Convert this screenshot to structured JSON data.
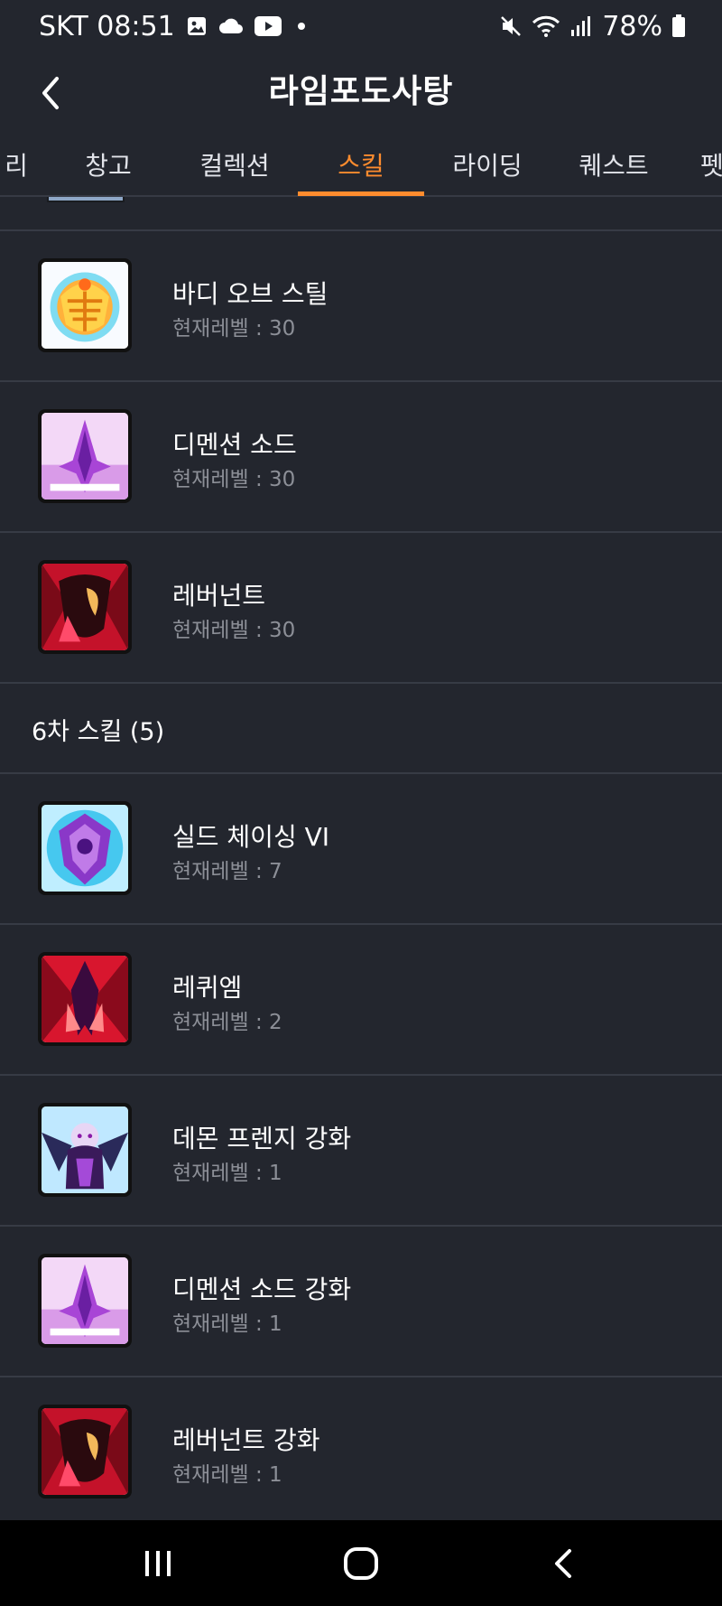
{
  "status_bar": {
    "carrier_time": "SKT 08:51",
    "battery": "78%",
    "icons": [
      "gallery-icon",
      "cloud-icon",
      "youtube-icon",
      "mute-icon",
      "wifi-icon",
      "signal-icon",
      "battery-icon"
    ]
  },
  "header": {
    "title": "라임포도사탕",
    "back_icon": "chevron-left-icon"
  },
  "tabs": [
    {
      "label": "리"
    },
    {
      "label": "창고"
    },
    {
      "label": "컬렉션"
    },
    {
      "label": "스킬",
      "active": true
    },
    {
      "label": "라이딩"
    },
    {
      "label": "퀘스트"
    },
    {
      "label": "펫"
    }
  ],
  "colors": {
    "accent": "#ff8c2e",
    "background": "#23262e",
    "divider": "#373b45",
    "secondary_text": "#8c8f97"
  },
  "skills_top": [
    {
      "name": "바디 오브 스틸",
      "level": "현재레벨 : 30",
      "icon": "body-of-steel-icon"
    },
    {
      "name": "디멘션 소드",
      "level": "현재레벨 : 30",
      "icon": "dimension-sword-icon"
    },
    {
      "name": "레버넌트",
      "level": "현재레벨 : 30",
      "icon": "revenant-icon"
    }
  ],
  "section_6th": {
    "title": "6차 스킬 (5)"
  },
  "skills_6th": [
    {
      "name": "실드 체이싱 VI",
      "level": "현재레벨 : 7",
      "icon": "shield-chasing-icon"
    },
    {
      "name": "레퀴엠",
      "level": "현재레벨 : 2",
      "icon": "requiem-icon"
    },
    {
      "name": "데몬 프렌지 강화",
      "level": "현재레벨 : 1",
      "icon": "demon-frenzy-icon"
    },
    {
      "name": "디멘션 소드 강화",
      "level": "현재레벨 : 1",
      "icon": "dimension-sword-icon"
    },
    {
      "name": "레버넌트 강화",
      "level": "현재레벨 : 1",
      "icon": "revenant-icon"
    }
  ],
  "nav_bar": {
    "icons": [
      "recent-apps-icon",
      "home-icon",
      "back-icon"
    ]
  }
}
